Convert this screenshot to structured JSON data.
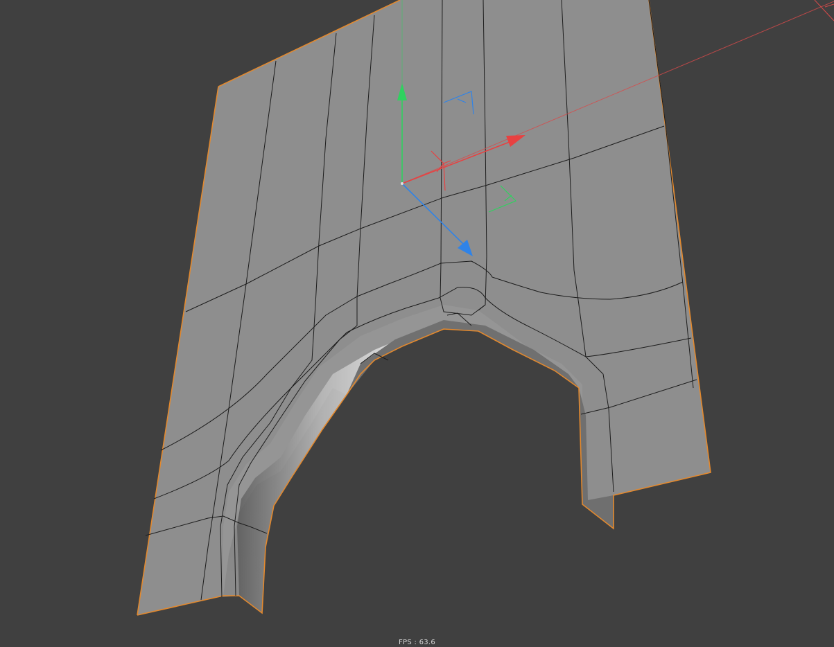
{
  "viewport": {
    "fps_label": "FPS : 63.6",
    "background_color": "#404040",
    "mesh": {
      "face_color": "#8d8d8d",
      "inner_face_color": "#6e6e6e",
      "edge_color": "#1a1a1a",
      "selection_outline_color": "#e3892e"
    },
    "gizmo": {
      "x_axis_color": "#e84141",
      "y_axis_color": "#2fd25f",
      "z_axis_color": "#2f83e8",
      "x_axis_icon": "arrow-icon",
      "y_axis_icon": "arrow-icon",
      "z_axis_icon": "arrow-icon"
    }
  }
}
